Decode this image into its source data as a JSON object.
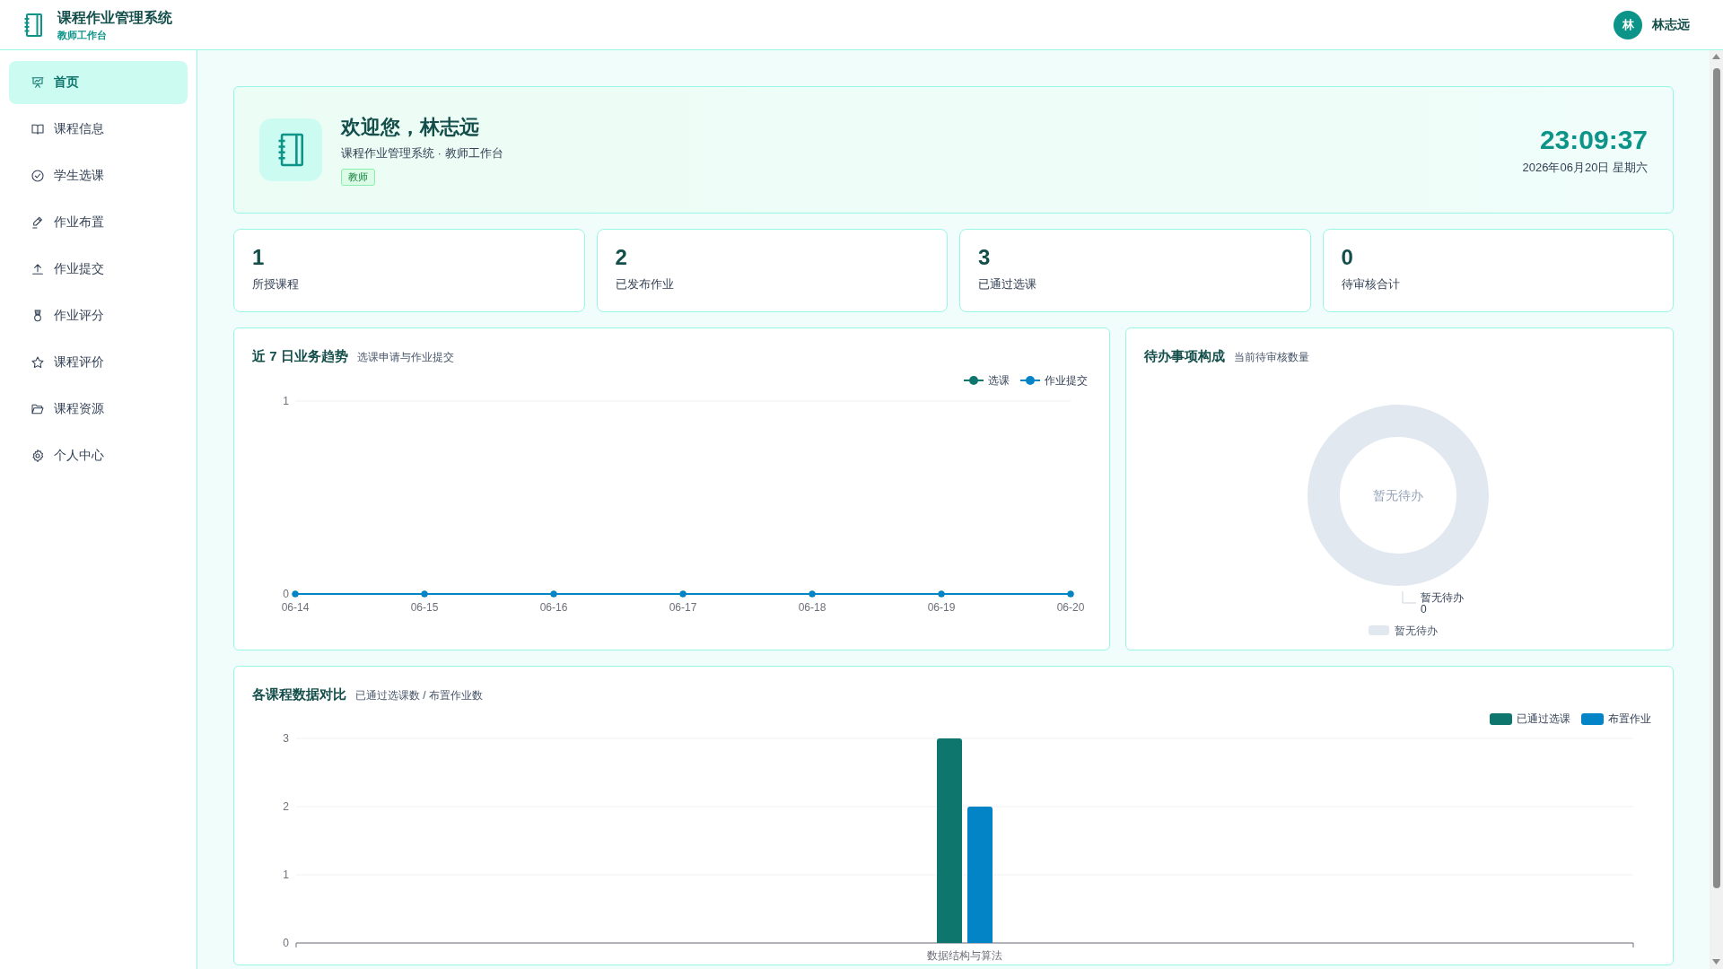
{
  "header": {
    "title": "课程作业管理系统",
    "subtitle": "教师工作台",
    "user": {
      "avatar_text": "林",
      "name": "林志远"
    }
  },
  "sidebar": {
    "items": [
      {
        "label": "首页",
        "selected": true
      },
      {
        "label": "课程信息",
        "selected": false
      },
      {
        "label": "学生选课",
        "selected": false
      },
      {
        "label": "作业布置",
        "selected": false
      },
      {
        "label": "作业提交",
        "selected": false
      },
      {
        "label": "作业评分",
        "selected": false
      },
      {
        "label": "课程评价",
        "selected": false
      },
      {
        "label": "课程资源",
        "selected": false
      },
      {
        "label": "个人中心",
        "selected": false
      }
    ]
  },
  "welcome": {
    "title": "欢迎您，林志远",
    "subtitle": "课程作业管理系统 · 教师工作台",
    "badge": "教师",
    "time": "23:09:37",
    "date": "2026年06月20日 星期六"
  },
  "stats": [
    {
      "value": "1",
      "label": "所授课程"
    },
    {
      "value": "2",
      "label": "已发布作业"
    },
    {
      "value": "3",
      "label": "已通过选课"
    },
    {
      "value": "0",
      "label": "待审核合计"
    }
  ],
  "trend_chart": {
    "title": "近 7 日业务趋势",
    "subtitle": "选课申请与作业提交",
    "chart_data": {
      "type": "line",
      "legend": "top-right",
      "x": [
        "06-14",
        "06-15",
        "06-16",
        "06-17",
        "06-18",
        "06-19",
        "06-20"
      ],
      "ylim": [
        0,
        1
      ],
      "yticks": [
        0,
        1
      ],
      "series": [
        {
          "name": "选课",
          "color": "#0f766e",
          "marker": "circle",
          "values": [
            0,
            0,
            0,
            0,
            0,
            0,
            0
          ]
        },
        {
          "name": "作业提交",
          "color": "#0284c7",
          "marker": "circle",
          "values": [
            0,
            0,
            0,
            0,
            0,
            0,
            0
          ]
        }
      ]
    }
  },
  "pending_chart": {
    "title": "待办事项构成",
    "subtitle": "当前待审核数量",
    "empty_ring": {
      "center_text": "暂无待办",
      "label": {
        "name": "暂无待办",
        "value": "0"
      },
      "legend": [
        {
          "name": "暂无待办"
        }
      ]
    }
  },
  "course_chart": {
    "title": "各课程数据对比",
    "subtitle": "已通过选课数 / 布置作业数",
    "chart_data": {
      "type": "bar",
      "legend": "top-right",
      "categories": [
        "数据结构与算法"
      ],
      "ylim": [
        0,
        3
      ],
      "yticks": [
        0,
        1,
        2,
        3
      ],
      "series": [
        {
          "name": "已通过选课",
          "color": "#0f766e",
          "values": [
            3
          ]
        },
        {
          "name": "布置作业",
          "color": "#0284c7",
          "values": [
            2
          ]
        }
      ]
    }
  }
}
